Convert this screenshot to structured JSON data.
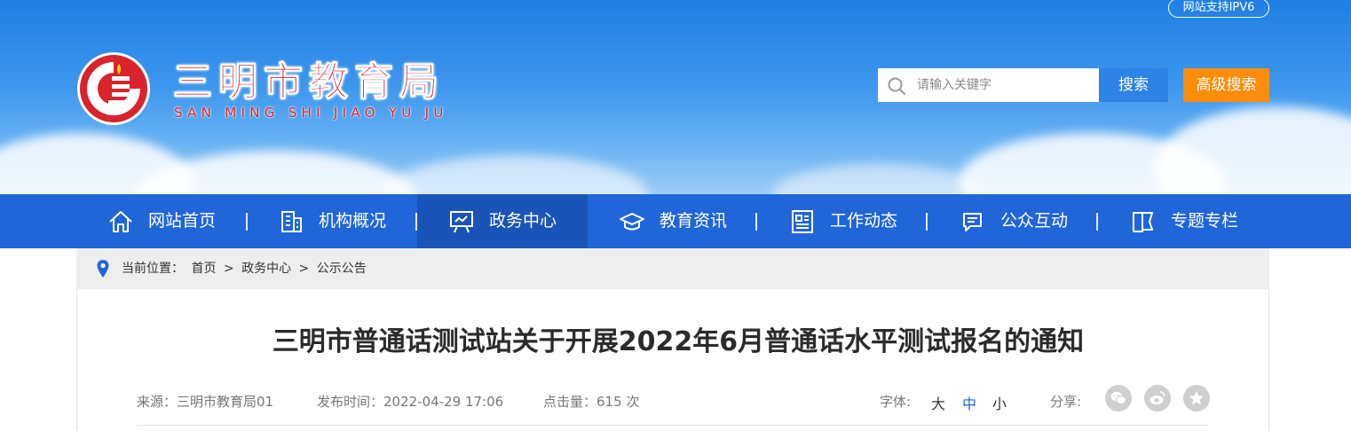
{
  "header": {
    "ipv6_badge": "网站支持IPV6",
    "site_name": "三明市教育局",
    "site_pinyin": "SAN MING SHI JIAO YU JU",
    "search": {
      "placeholder": "请输入关键字",
      "button": "搜索",
      "advanced": "高级搜索"
    },
    "colors": {
      "brand_red": "#d9232d",
      "nav_blue": "#2166d8",
      "search_btn": "#2d83e6",
      "advanced_btn": "#fb8c0c"
    }
  },
  "nav": {
    "items": [
      {
        "label": "网站首页",
        "icon": "home-icon"
      },
      {
        "label": "机构概况",
        "icon": "building-icon"
      },
      {
        "label": "政务中心",
        "icon": "presentation-icon",
        "active": true
      },
      {
        "label": "教育资讯",
        "icon": "graduation-cap-icon"
      },
      {
        "label": "工作动态",
        "icon": "newspaper-icon"
      },
      {
        "label": "公众互动",
        "icon": "chat-icon"
      },
      {
        "label": "专题专栏",
        "icon": "book-icon"
      }
    ]
  },
  "breadcrumb": {
    "prefix": "当前位置：",
    "path": [
      "首页",
      "政务中心",
      "公示公告"
    ],
    "separator": ">"
  },
  "article": {
    "title": "三明市普通话测试站关于开展2022年6月普通话水平测试报名的通知",
    "source_label": "来源：",
    "source": "三明市教育局01",
    "time_label": "发布时间：",
    "time": "2022-04-29 17:06",
    "hits_label": "点击量：",
    "hits": "615",
    "hits_unit": "次",
    "font_label": "字体:",
    "font_sizes": [
      "大",
      "中",
      "小"
    ],
    "font_selected": "中",
    "share_label": "分享:",
    "share_targets": [
      "wechat-icon",
      "weibo-icon",
      "favorite-star-icon"
    ]
  }
}
